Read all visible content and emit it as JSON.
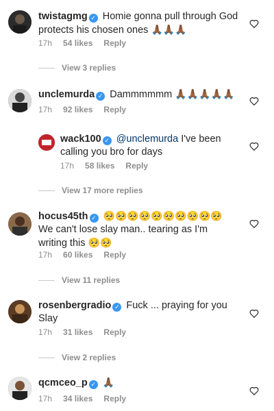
{
  "comments": [
    {
      "username": "twistagmg",
      "text": "Homie gonna pull through God protects his chosen ones",
      "emoji": "🙏🏾🙏🏾🙏🏾",
      "time": "17h",
      "likes": "54 likes",
      "reply": "Reply",
      "view_replies": "View 3 replies"
    },
    {
      "username": "unclemurda",
      "text": "Dammmmmm",
      "emoji": "🙏🏾🙏🏾🙏🏾🙏🏾🙏🏾",
      "time": "17h",
      "likes": "92 likes",
      "reply": "Reply"
    },
    {
      "username": "wack100",
      "mention": "@unclemurda",
      "text": "I've been calling you bro for days",
      "time": "17h",
      "likes": "58 likes",
      "reply": "Reply",
      "view_replies": "View 17 more replies"
    },
    {
      "username": "hocus45th",
      "emoji_line": "🥺🥺🥺🥺🥺🥺🥺🥺🥺🥺",
      "text": "We can't lose slay man.. tearing as I'm writing this",
      "emoji": "🥺🥺",
      "time": "17h",
      "likes": "60 likes",
      "reply": "Reply",
      "view_replies": "View 11 replies"
    },
    {
      "username": "rosenbergradio",
      "text": "Fuck ... praying for you Slay",
      "time": "17h",
      "likes": "31 likes",
      "reply": "Reply",
      "view_replies": "View 2 replies"
    },
    {
      "username": "qcmceo_p",
      "emoji": "🙏🏾",
      "time": "17h",
      "likes": "34 likes",
      "reply": "Reply"
    }
  ],
  "icons": {
    "verified": "verified-badge-icon",
    "like": "heart-icon"
  },
  "colors": {
    "verified": "#3897f0",
    "mention": "#00376b",
    "meta": "#8e8e8e"
  }
}
